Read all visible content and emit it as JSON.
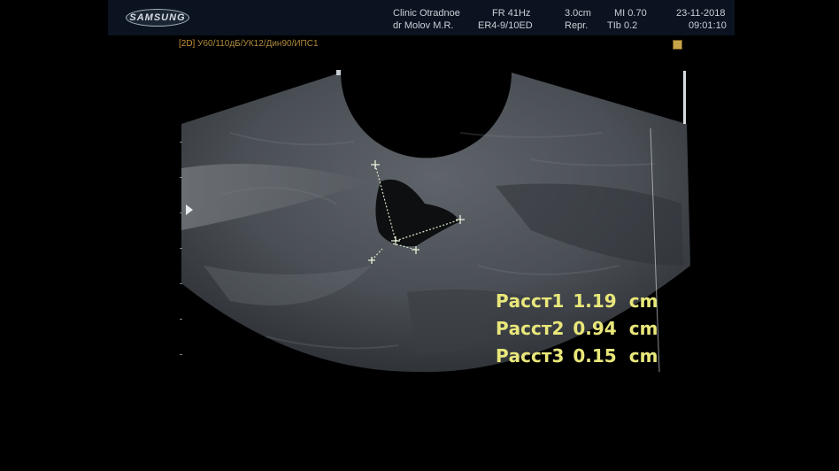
{
  "header": {
    "brand": "SAMSUNG",
    "clinic": "Clinic Otradnoe",
    "operator": "dr Molov M.R.",
    "frame_rate": "FR 41Hz",
    "probe": "ER4-9/10ED",
    "depth": "3.0cm",
    "preset": "Repr.",
    "mi": "MI  0.70",
    "tib": "TIb  0.2",
    "date": "23-11-2018",
    "time": "09:01:10"
  },
  "mode_line": {
    "badge": "[2D]",
    "params": "У60/110дБ/УК12/Дин90/ИПС1"
  },
  "measurements": [
    {
      "label": "Расст1",
      "value": "1.19",
      "unit": "cm"
    },
    {
      "label": "Расст2",
      "value": "0.94",
      "unit": "cm"
    },
    {
      "label": "Расст3",
      "value": "0.15",
      "unit": "cm"
    }
  ],
  "colors": {
    "measurement_text": "#e9e77a",
    "caliper": "#cfe3b0",
    "header_bg": "#0b1320"
  }
}
